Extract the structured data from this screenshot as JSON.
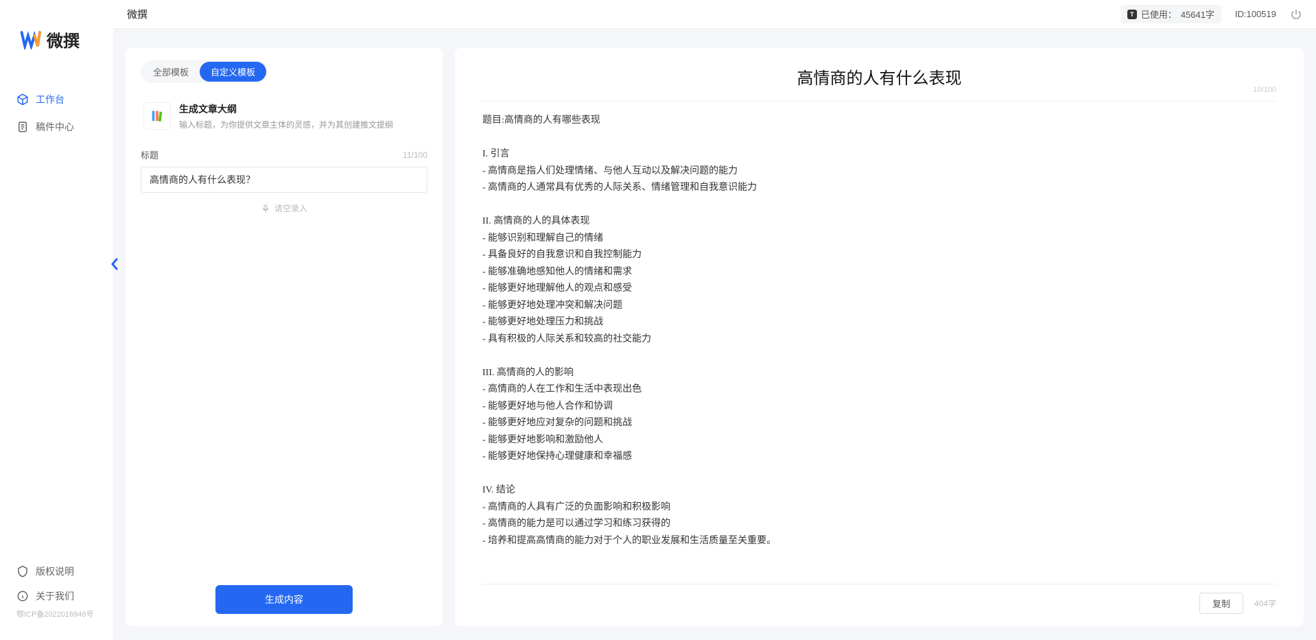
{
  "app": {
    "name": "微撰"
  },
  "sidebar": {
    "nav": [
      {
        "label": "工作台",
        "icon": "cube"
      },
      {
        "label": "稿件中心",
        "icon": "doc"
      }
    ],
    "bottom": [
      {
        "label": "版权说明",
        "icon": "shield"
      },
      {
        "label": "关于我们",
        "icon": "info"
      }
    ],
    "icp": "鄂ICP备2022016946号"
  },
  "topbar": {
    "usage_label": "已使用：",
    "usage_value": "45641字",
    "id_label": "ID:100519"
  },
  "left_panel": {
    "tabs": [
      "全部模板",
      "自定义模板"
    ],
    "active_tab": 1,
    "template": {
      "title": "生成文章大纲",
      "desc": "输入标题，为你提供文章主体的灵感，并为其创建推文提纲",
      "icon": "📚"
    },
    "title_field": {
      "label": "标题",
      "value": "高情商的人有什么表现？",
      "count": "11/100"
    },
    "voice_hint": "请空录入",
    "generate_label": "生成内容"
  },
  "output": {
    "title": "高情商的人有什么表现",
    "title_count": "10/100",
    "body": "题目:高情商的人有哪些表现\n\nI. 引言\n- 高情商是指人们处理情绪、与他人互动以及解决问题的能力\n- 高情商的人通常具有优秀的人际关系、情绪管理和自我意识能力\n\nII. 高情商的人的具体表现\n- 能够识别和理解自己的情绪\n- 具备良好的自我意识和自我控制能力\n- 能够准确地感知他人的情绪和需求\n- 能够更好地理解他人的观点和感受\n- 能够更好地处理冲突和解决问题\n- 能够更好地处理压力和挑战\n- 具有积极的人际关系和较高的社交能力\n\nIII. 高情商的人的影响\n- 高情商的人在工作和生活中表现出色\n- 能够更好地与他人合作和协调\n- 能够更好地应对复杂的问题和挑战\n- 能够更好地影响和激励他人\n- 能够更好地保持心理健康和幸福感\n\nIV. 结论\n- 高情商的人具有广泛的负面影响和积极影响\n- 高情商的能力是可以通过学习和练习获得的\n- 培养和提高高情商的能力对于个人的职业发展和生活质量至关重要。",
    "copy_label": "复制",
    "word_count": "404字"
  }
}
